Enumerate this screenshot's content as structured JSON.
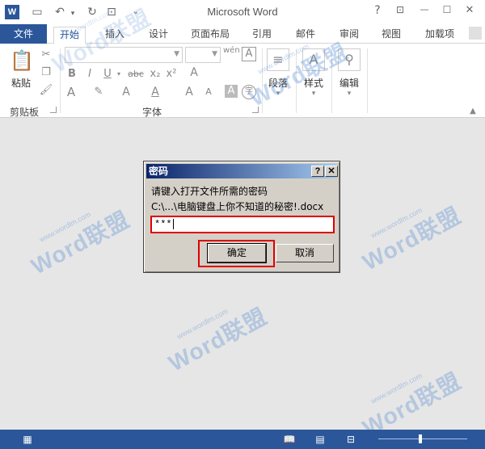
{
  "titlebar": {
    "title": "Microsoft Word",
    "app_icon": "W",
    "quick_access": {
      "save_icon": "save-icon",
      "undo_icon": "undo-icon",
      "redo_icon": "redo-icon",
      "preview_icon": "print-preview-icon",
      "customize_icon": "customize-icon"
    },
    "controls": {
      "help": "?",
      "ribbon_options": "⊡",
      "minimize": "—",
      "restore": "☐",
      "close": "✕"
    }
  },
  "ribbon_tabs": [
    {
      "label": "文件"
    },
    {
      "label": "开始"
    },
    {
      "label": "插入"
    },
    {
      "label": "设计"
    },
    {
      "label": "页面布局"
    },
    {
      "label": "引用"
    },
    {
      "label": "邮件"
    },
    {
      "label": "审阅"
    },
    {
      "label": "视图"
    },
    {
      "label": "加载项"
    }
  ],
  "ribbon": {
    "clipboard": {
      "paste_label": "粘贴",
      "group_label": "剪贴板"
    },
    "font": {
      "group_label": "字体",
      "font_name": "",
      "font_size": "",
      "buttons": [
        "B",
        "I",
        "U",
        "abc",
        "x₂",
        "x²",
        "A",
        "A",
        "A",
        "A",
        "A",
        "A",
        "wén",
        "A"
      ]
    },
    "paragraph": {
      "label": "段落"
    },
    "styles": {
      "label": "样式"
    },
    "editing": {
      "label": "编辑"
    }
  },
  "dialog": {
    "title": "密码",
    "help_button": "?",
    "close_button": "✕",
    "prompt": "请键入打开文件所需的密码",
    "file_path": "C:\\...\\电脑键盘上你不知道的秘密!.docx",
    "password_value": "***",
    "ok_label": "确定",
    "cancel_label": "取消"
  },
  "watermark": {
    "brand": "Word联盟",
    "url": "www.wordlm.com"
  },
  "colors": {
    "accent": "#2b579a",
    "highlight": "#e00000",
    "dialog_bg": "#d4d0c8",
    "title_gradient_start": "#0a246a"
  }
}
